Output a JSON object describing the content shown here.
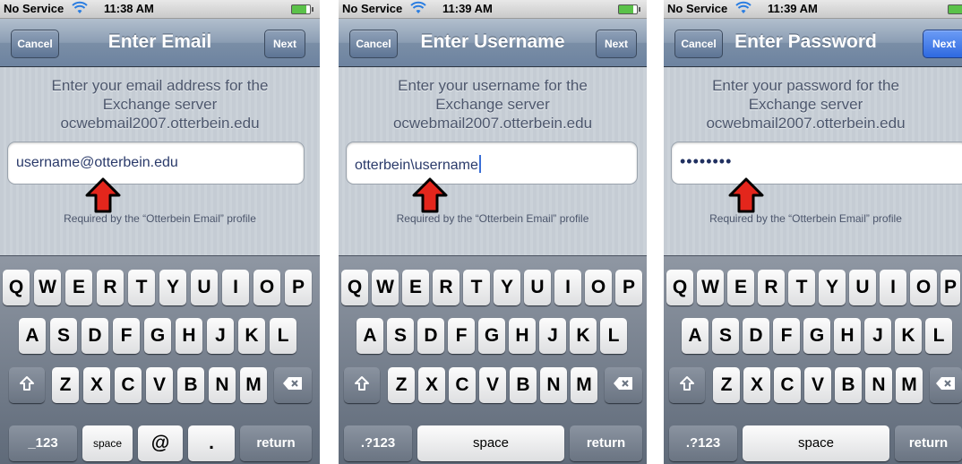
{
  "panels": [
    {
      "status": {
        "carrier": "No Service",
        "time": "11:38 AM"
      },
      "nav": {
        "cancel": "Cancel",
        "title": "Enter Email",
        "next": "Next"
      },
      "instruction": [
        "Enter your email address for the",
        "Exchange server",
        "ocwebmail2007.otterbein.edu"
      ],
      "field_value": "username@otterbein.edu",
      "required_note": "Required by the “Otterbein Email” profile",
      "keyboard": {
        "row1": [
          "Q",
          "W",
          "E",
          "R",
          "T",
          "Y",
          "U",
          "I",
          "O",
          "P"
        ],
        "row2": [
          "A",
          "S",
          "D",
          "F",
          "G",
          "H",
          "J",
          "K",
          "L"
        ],
        "row3": [
          "Z",
          "X",
          "C",
          "V",
          "B",
          "N",
          "M"
        ],
        "bottom": [
          "_123",
          "space",
          "@",
          ".",
          "return"
        ]
      }
    },
    {
      "status": {
        "carrier": "No Service",
        "time": "11:39 AM"
      },
      "nav": {
        "cancel": "Cancel",
        "title": "Enter Username",
        "next": "Next"
      },
      "instruction": [
        "Enter your username for the",
        "Exchange server",
        "ocwebmail2007.otterbein.edu"
      ],
      "field_value": "otterbein\\username",
      "required_note": "Required by the “Otterbein Email” profile",
      "keyboard": {
        "row1": [
          "Q",
          "W",
          "E",
          "R",
          "T",
          "Y",
          "U",
          "I",
          "O",
          "P"
        ],
        "row2": [
          "A",
          "S",
          "D",
          "F",
          "G",
          "H",
          "J",
          "K",
          "L"
        ],
        "row3": [
          "Z",
          "X",
          "C",
          "V",
          "B",
          "N",
          "M"
        ],
        "bottom": [
          ".?123",
          "space",
          "return"
        ]
      }
    },
    {
      "status": {
        "carrier": "No Service",
        "time": "11:39 AM"
      },
      "nav": {
        "cancel": "Cancel",
        "title": "Enter Password",
        "next": "Next"
      },
      "instruction": [
        "Enter your password for the",
        "Exchange server",
        "ocwebmail2007.otterbein.edu"
      ],
      "field_value": "••••••••",
      "required_note": "Required by the “Otterbein Email” profile",
      "keyboard": {
        "row1": [
          "Q",
          "W",
          "E",
          "R",
          "T",
          "Y",
          "U",
          "I",
          "O",
          "P"
        ],
        "row2": [
          "A",
          "S",
          "D",
          "F",
          "G",
          "H",
          "J",
          "K",
          "L"
        ],
        "row3": [
          "Z",
          "X",
          "C",
          "V",
          "B",
          "N",
          "M"
        ],
        "bottom": [
          ".?123",
          "space",
          "return"
        ]
      }
    }
  ],
  "icons": {
    "wifi": "wifi-icon",
    "battery": "battery-icon",
    "shift": "shift-icon",
    "delete": "delete-icon",
    "arrow": "red-up-arrow-icon"
  },
  "colors": {
    "arrow_red": "#e3261c",
    "next_blue": "#2e69e0",
    "nav_bg": "#7a8ea6"
  }
}
